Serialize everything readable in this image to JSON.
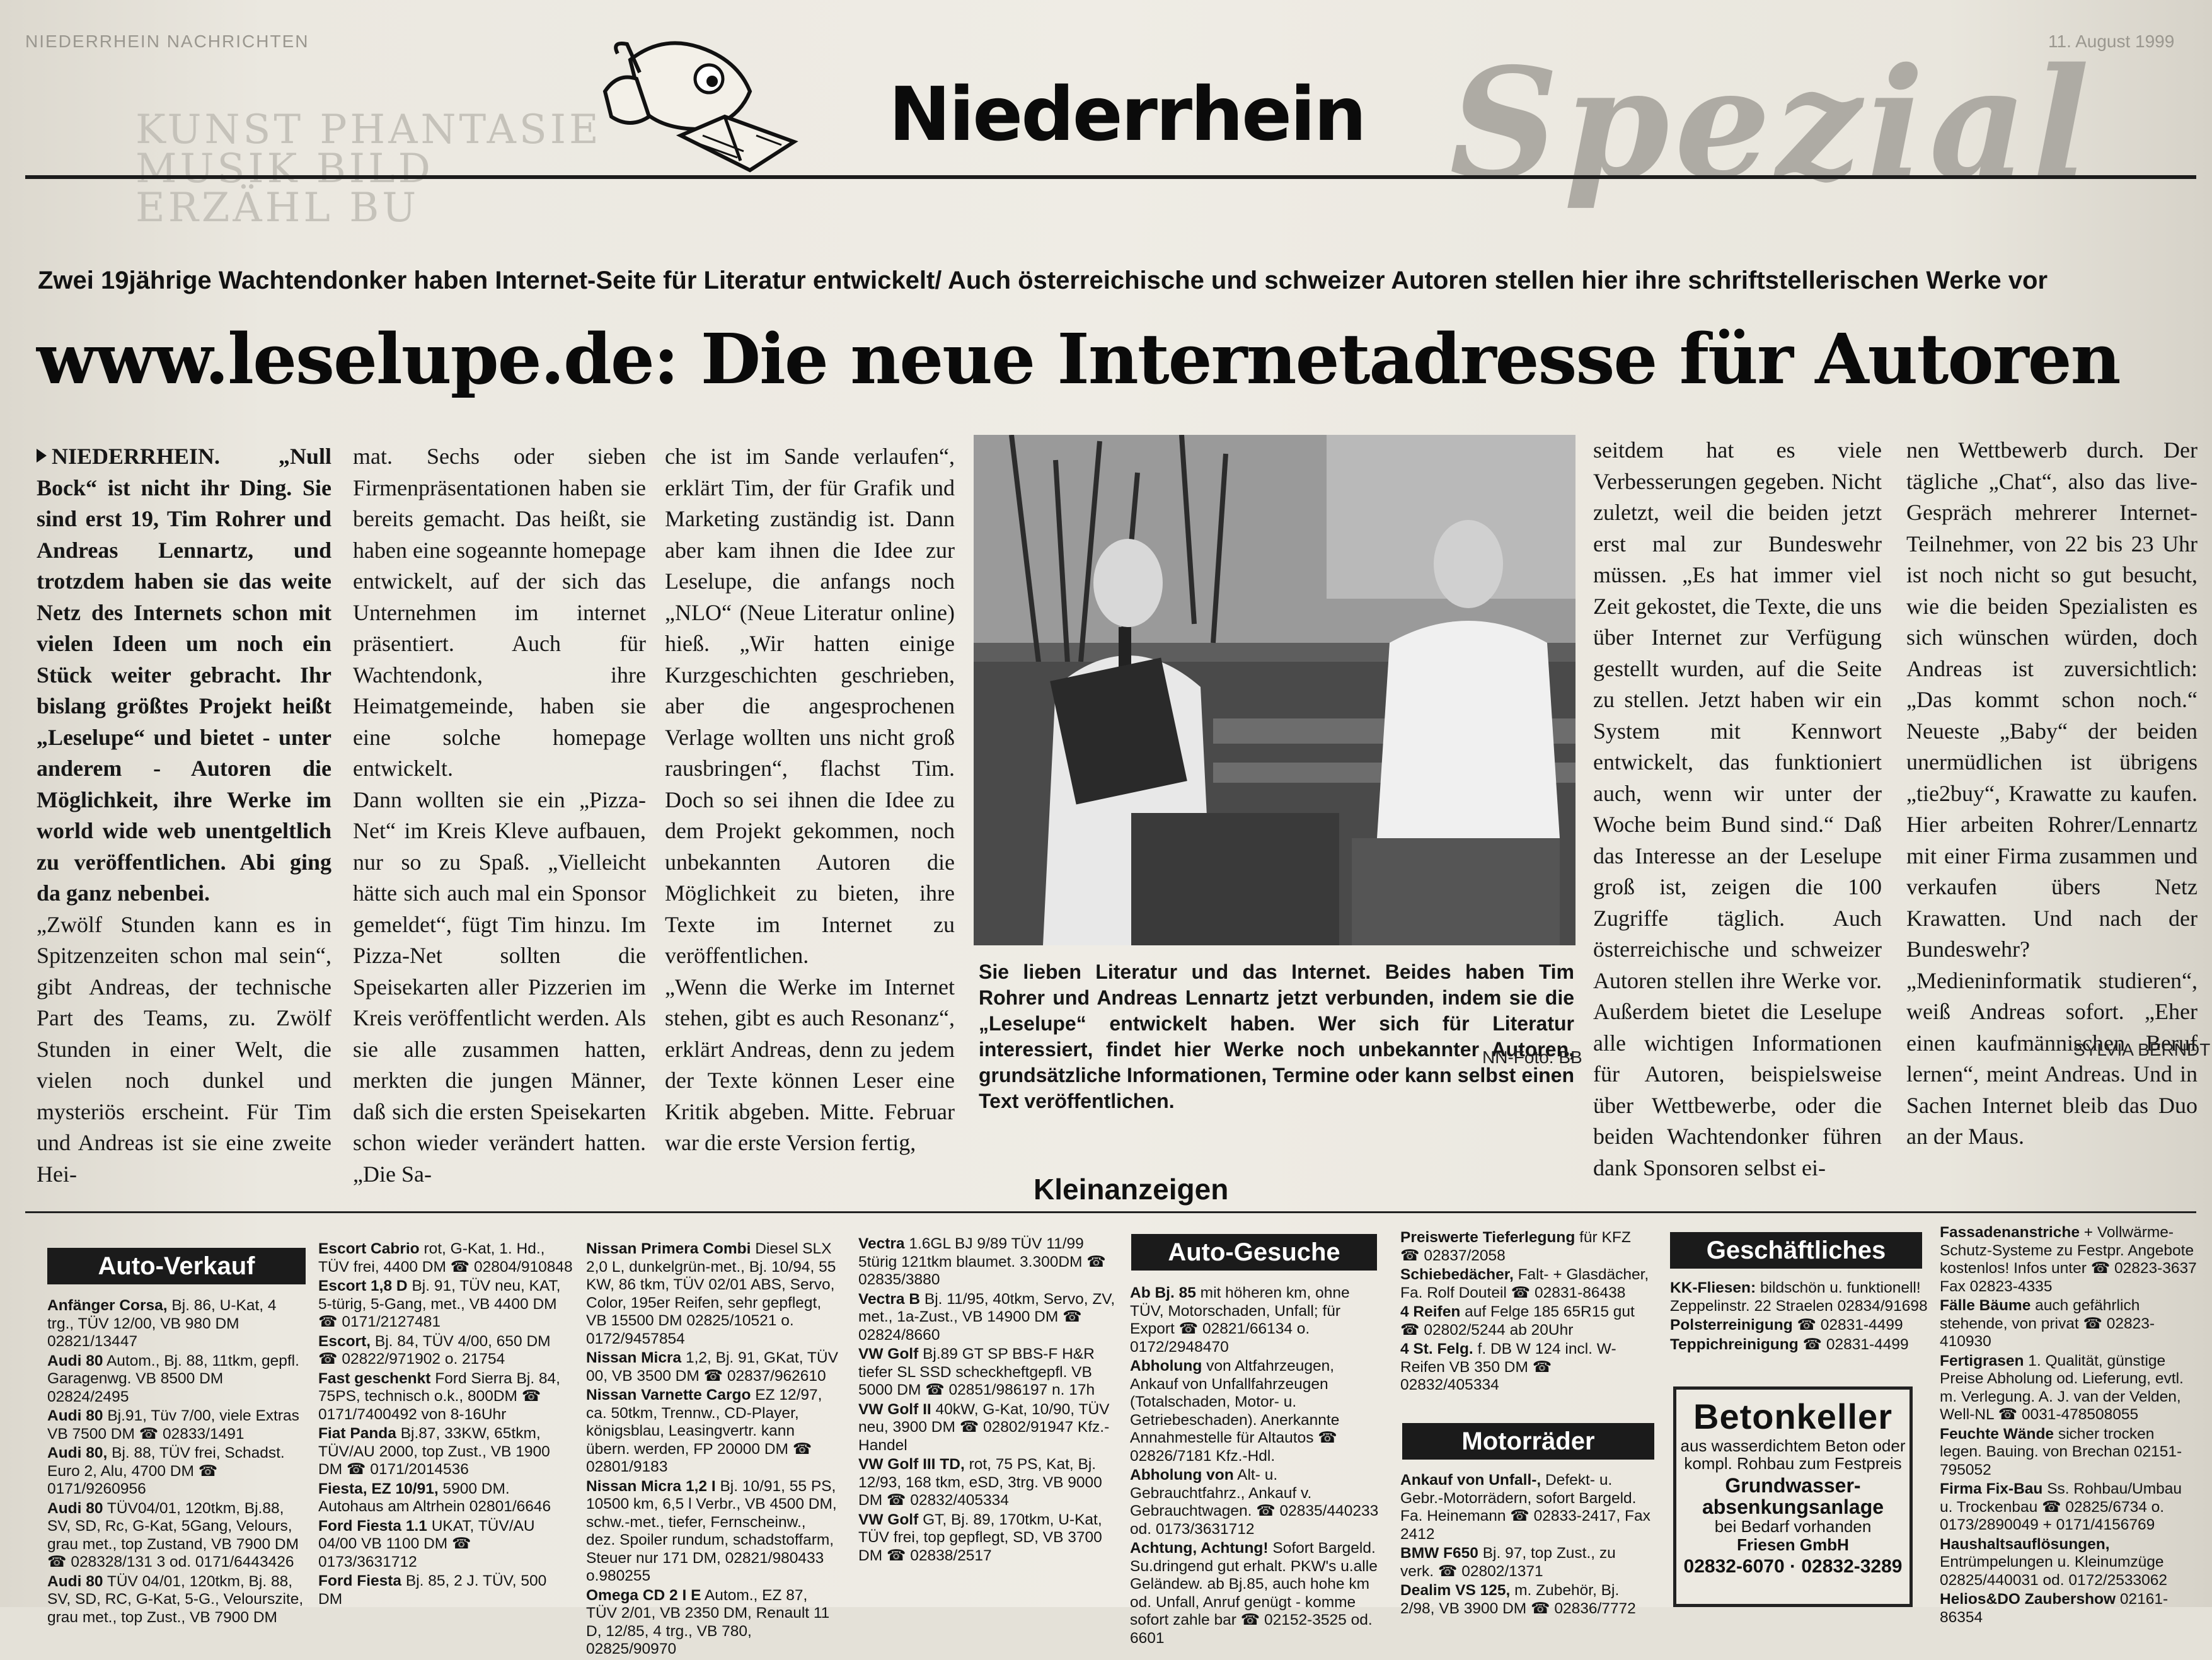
{
  "masthead": {
    "running_header": "NIEDERRHEIN NACHRICHTEN",
    "date": "11. August 1999",
    "ghost_text": [
      "KUNST PHANTASIE",
      "MUSIK BILD ERZÄHL BU"
    ],
    "brand": "Niederrhein",
    "section": "Spezial"
  },
  "article": {
    "kicker": "Zwei 19jährige Wachtendonker haben Internet-Seite für Literatur entwickelt/ Auch österreichische und schweizer Autoren stellen hier ihre schriftstellerischen Werke vor",
    "headline": "www.leselupe.de: Die neue Internetadresse für Autoren",
    "col1_lead": "NIEDERRHEIN. „Null Bock“ ist nicht ihr Ding. Sie sind erst 19, Tim Rohrer und Andreas Lennartz, und trotzdem haben sie das weite Netz des Internets schon mit vielen Ideen um noch ein Stück weiter gebracht. Ihr bislang größtes Projekt heißt „Leselupe“ und bietet - unter anderem - Autoren die Möglichkeit, ihre Werke im world wide web unentgeltlich zu veröffentlichen. Abi ging da ganz nebenbei.",
    "col1_text": "„Zwölf Stunden kann es in Spitzenzeiten schon mal sein“, gibt Andreas, der technische Part des Teams, zu. Zwölf Stunden in einer Welt, die vielen noch dunkel und mysteriös erscheint. Für Tim und Andreas ist sie eine zweite Hei-",
    "col2_p1": "mat. Sechs oder sieben Firmenpräsentationen haben sie bereits gemacht. Das heißt, sie haben eine sogeannte homepage entwickelt, auf der sich das Unternehmen im internet präsentiert. Auch für Wachtendonk, ihre Heimatgemeinde, haben sie eine solche homepage entwickelt.",
    "col2_p2": "Dann wollten sie ein „Pizza-Net“ im Kreis Kleve aufbauen, nur so zu Spaß. „Vielleicht hätte sich auch mal ein Sponsor gemeldet“, fügt Tim hinzu. Im Pizza-Net sollten die Speisekarten aller Pizzerien im Kreis veröffentlicht werden. Als sie alle zusammen hatten, merkten die jungen Männer, daß sich die ersten Speisekarten schon wieder verändert hatten. „Die Sa-",
    "col3_p1": "che ist im Sande verlaufen“, erklärt Tim, der für Grafik und Marketing zuständig ist. Dann aber kam ihnen die Idee zur Leselupe, die anfangs noch „NLO“ (Neue Literatur online) hieß. „Wir hatten einige Kurzgeschichten geschrieben, aber die angesprochenen Verlage wollten uns nicht groß rausbringen“, flachst Tim. Doch so sei ihnen die Idee zu dem Projekt gekommen, noch unbekannten Autoren die Möglichkeit zu bieten, ihre Texte im Internet zu veröffentlichen.",
    "col3_p2": "„Wenn die Werke im Internet stehen, gibt es auch Resonanz“, erklärt Andreas, denn zu jedem der Texte können Leser eine Kritik abgeben. Mitte. Februar war die erste Version fertig,",
    "caption": "Sie lieben Literatur und das Internet. Beides haben Tim Rohrer und Andreas Lennartz jetzt verbunden, indem sie die „Leselupe“ entwickelt haben. Wer sich für Literatur interessiert, findet hier Werke noch unbekannter Autoren, grundsätzliche Informationen, Termine oder kann selbst einen Text veröffentlichen.",
    "photo_credit": "NN-Foto: BB",
    "col4_text": "seitdem hat es viele Verbesserungen gegeben. Nicht zuletzt, weil die beiden jetzt erst mal zur Bundeswehr müssen. „Es hat immer viel Zeit gekostet, die Texte, die uns über Internet zur Verfügung gestellt wurden, auf die Seite zu stellen. Jetzt haben wir ein System mit Kennwort entwickelt, das funktioniert auch, wenn wir unter der Woche beim Bund sind.“ Daß das Interesse an der Leselupe groß ist, zeigen die 100 Zugriffe täglich. Auch österreichische und schweizer Autoren stellen ihre Werke vor. Außerdem bietet die Leselupe alle wichtigen Informationen für Autoren, beispielsweise über Wettbewerbe, oder die beiden Wachtendonker führen dank Sponsoren selbst ei-",
    "col5_text": "nen Wettbewerb durch. Der tägliche „Chat“, also das live-Gespräch mehrerer Internet-Teilnehmer, von 22 bis 23 Uhr ist noch nicht so gut besucht, wie die beiden Spezialisten es sich wünschen würden, doch Andreas ist zuversichtlich: „Das kommt schon noch.“ Neueste „Baby“ der beiden unermüdlichen ist übrigens „tie2buy“, Krawatte zu kaufen. Hier arbeiten Rohrer/Lennartz mit einer Firma zusammen und verkaufen übers Netz Krawatten. Und nach der Bundeswehr? „Medieninformatik studieren“, weiß Andreas sofort. „Eher einen kaufmännischen Beruf lernen“, meint Andreas. Und in Sachen Internet bleib das Duo an der Maus.",
    "author": "SYLVIA BERNDT"
  },
  "classifieds": {
    "title": "Kleinanzeigen",
    "auto_verkauf": {
      "header": "Auto-Verkauf",
      "c1": [
        {
          "bold": "Anfänger Corsa,",
          "text": "Bj. 86, U-Kat, 4 trg., TÜV 12/00, VB 980 DM 02821/13447"
        },
        {
          "bold": "Audi 80",
          "text": "Autom., Bj. 88, 11tkm, gepfl. Garagenwg. VB 8500 DM 02824/2495"
        },
        {
          "bold": "Audi 80",
          "text": "Bj.91, Tüv 7/00, viele Extras VB 7500 DM ☎ 02833/1491"
        },
        {
          "bold": "Audi 80,",
          "text": "Bj. 88, TÜV frei, Schadst. Euro 2, Alu, 4700 DM ☎ 0171/9260956"
        },
        {
          "bold": "Audi 80",
          "text": "TÜV04/01, 120tkm, Bj.88, SV, SD, Rc, G-Kat, 5Gang, Velours, grau met., top Zustand, VB 7900 DM ☎ 028328/131 3 od. 0171/6443426"
        },
        {
          "bold": "Audi 80",
          "text": "TÜV 04/01, 120tkm, Bj. 88, SV, SD, RC, G-Kat, 5-G., Velourszite, grau met., top Zust., VB 7900 DM"
        }
      ],
      "c2": [
        {
          "bold": "Escort Cabrio",
          "text": "rot, G-Kat, 1. Hd., TÜV frei, 4400 DM ☎ 02804/910848"
        },
        {
          "bold": "Escort 1,8 D",
          "text": "Bj. 91, TÜV neu, KAT, 5-türig, 5-Gang, met., VB 4400 DM ☎ 0171/2127481"
        },
        {
          "bold": "Escort,",
          "text": "Bj. 84, TÜV 4/00, 650 DM ☎ 02822/971902 o. 21754"
        },
        {
          "bold": "Fast geschenkt",
          "text": "Ford Sierra Bj. 84, 75PS, technisch o.k., 800DM ☎ 0171/7400492 von 8-16Uhr"
        },
        {
          "bold": "Fiat Panda",
          "text": "Bj.87, 33KW, 65tkm, TÜV/AU 2000, top Zust., VB 1900 DM ☎ 0171/2014536"
        },
        {
          "bold": "Fiesta, EZ 10/91,",
          "text": "5900 DM. Autohaus am Altrhein 02801/6646"
        },
        {
          "bold": "Ford Fiesta 1.1",
          "text": "UKAT, TÜV/AU 04/00 VB 1100 DM ☎ 0173/3631712"
        },
        {
          "bold": "Ford Fiesta",
          "text": "Bj. 85, 2 J. TÜV, 500 DM"
        }
      ],
      "c3": [
        {
          "bold": "Nissan Primera Combi",
          "text": "Diesel SLX 2,0 L, dunkelgrün-met., Bj. 10/94, 55 KW, 86 tkm, TÜV 02/01 ABS, Servo, Color, 195er Reifen, sehr gepflegt, VB 15500 DM 02825/10521 o. 0172/9457854"
        },
        {
          "bold": "Nissan Micra",
          "text": "1,2, Bj. 91, GKat, TÜV 00, VB 3500 DM ☎ 02837/962610"
        },
        {
          "bold": "Nissan Varnette Cargo",
          "text": "EZ 12/97, ca. 50tkm, Trennw., CD-Player, königsblau, Leasingvertr. kann übern. werden, FP 20000 DM ☎ 02801/9183"
        },
        {
          "bold": "Nissan Micra 1,2 I",
          "text": "Bj. 10/91, 55 PS, 10500 km, 6,5 l Verbr., VB 4500 DM, schw.-met., tiefer, Fernscheinw., dez. Spoiler rundum, schadstoffarm, Steuer nur 171 DM, 02821/980433 o.980255"
        },
        {
          "bold": "Omega CD 2 I E",
          "text": "Autom., EZ 87, TÜV 2/01, VB 2350 DM, Renault 11 D, 12/85, 4 trg., VB 780, 02825/90970"
        }
      ],
      "c4": [
        {
          "bold": "Vectra",
          "text": "1.6GL BJ 9/89 TÜV 11/99 5türig 121tkm blaumet. 3.300DM ☎ 02835/3880"
        },
        {
          "bold": "Vectra B",
          "text": "Bj. 11/95, 40tkm, Servo, ZV, met., 1a-Zust., VB 14900 DM ☎ 02824/8660"
        },
        {
          "bold": "VW Golf",
          "text": "Bj.89 GT SP BBS-F H&R tiefer SL SSD scheckheftgepfl. VB 5000 DM ☎ 02851/986197 n. 17h"
        },
        {
          "bold": "VW Golf II",
          "text": "40kW, G-Kat, 10/90, TÜV neu, 3900 DM ☎ 02802/91947 Kfz.-Handel"
        },
        {
          "bold": "VW Golf III TD,",
          "text": "rot, 75 PS, Kat, Bj. 12/93, 168 tkm, eSD, 3trg. VB 9000 DM ☎ 02832/405334"
        },
        {
          "bold": "VW Golf",
          "text": "GT, Bj. 89, 170tkm, U-Kat, TÜV frei, top gepflegt, SD, VB 3700 DM ☎ 02838/2517"
        }
      ]
    },
    "auto_gesuche": {
      "header": "Auto-Gesuche",
      "items": [
        {
          "bold": "Ab Bj. 85",
          "text": "mit höheren km, ohne TÜV, Motorschaden, Unfall; für Export ☎ 02821/66134 o. 0172/2948470"
        },
        {
          "bold": "Abholung",
          "text": "von Altfahrzeugen, Ankauf von Unfallfahrzeugen (Totalschaden, Motor- u. Getriebeschaden). Anerkannte Annahmestelle für Altautos ☎ 02826/7181 Kfz.-Hdl."
        },
        {
          "bold": "Abholung von",
          "text": "Alt- u. Gebrauchtfahrz., Ankauf v. Gebrauchtwagen. ☎ 02835/440233 od. 0173/3631712"
        },
        {
          "bold": "Achtung, Achtung!",
          "text": "Sofort Bargeld. Su.dringend gut erhalt. PKW's u.alle Geländew. ab Bj.85, auch hohe km od. Unfall, Anruf genügt - komme sofort zahle bar ☎ 02152-3525 od. 6601"
        }
      ],
      "c6": [
        {
          "bold": "Preiswerte Tieferlegung",
          "text": "für KFZ ☎ 02837/2058"
        },
        {
          "bold": "Schiebedächer,",
          "text": "Falt- + Glasdächer, Fa. Rolf Douteil ☎ 02831-86438"
        },
        {
          "bold": "4 Reifen",
          "text": "auf Felge 185 65R15 gut ☎ 02802/5244 ab 20Uhr"
        },
        {
          "bold": "4 St. Felg.",
          "text": "f. DB W 124 incl. W-Reifen VB 350 DM ☎ 02832/405334"
        }
      ]
    },
    "motorraeder": {
      "header": "Motorräder",
      "items": [
        {
          "bold": "Ankauf von Unfall-,",
          "text": "Defekt- u. Gebr.-Motorrädern, sofort Bargeld. Fa. Heinemann ☎ 02833-2417, Fax 2412"
        },
        {
          "bold": "BMW F650",
          "text": "Bj. 97, top Zust., zu verk. ☎ 02802/1371"
        },
        {
          "bold": "Dealim VS 125,",
          "text": "m. Zubehör, Bj. 2/98, VB 3900 DM ☎ 02836/7772"
        }
      ]
    },
    "geschaeftliches": {
      "header": "Geschäftliches",
      "items": [
        {
          "bold": "KK-Fliesen:",
          "text": "bildschön u. funktionell! Zeppelinstr. 22 Straelen 02834/91698"
        },
        {
          "bold": "Polsterreinigung",
          "text": "☎ 02831-4499"
        },
        {
          "bold": "Teppichreinigung",
          "text": "☎ 02831-4499"
        }
      ],
      "c8": [
        {
          "bold": "Fassadenanstriche",
          "text": "+ Vollwärme-Schutz-Systeme zu Festpr. Angebote kostenlos! Infos unter ☎ 02823-3637 Fax 02823-4335"
        },
        {
          "bold": "Fälle Bäume",
          "text": "auch gefährlich stehende, von privat ☎ 02823-410930"
        },
        {
          "bold": "Fertigrasen",
          "text": "1. Qualität, günstige Preise Abholung od. Lieferung, evtl. m. Verlegung. A. J. van der Velden, Well-NL ☎ 0031-478508055"
        },
        {
          "bold": "Feuchte Wände",
          "text": "sicher trocken legen. Bauing. von Brechan 02151-795052"
        },
        {
          "bold": "Firma Fix-Bau",
          "text": "Ss. Rohbau/Umbau u. Trockenbau ☎ 02825/6734 o. 0173/2890049 + 0171/4156769"
        },
        {
          "bold": "Haushaltsauflösungen,",
          "text": "Entrümpelungen u. Kleinumzüge 02825/440031 od. 0172/2533062"
        },
        {
          "bold": "Helios&DO Zaubershow",
          "text": "02161-86354"
        }
      ]
    },
    "betonkeller": {
      "title": "Betonkeller",
      "line1": "aus wasserdichtem Beton oder kompl. Rohbau zum Festpreis",
      "line2": "Grundwasser-absenkungsanlage",
      "line3": "bei Bedarf vorhanden",
      "company": "Friesen GmbH",
      "phones": "02832-6070 · 02832-3289"
    }
  }
}
